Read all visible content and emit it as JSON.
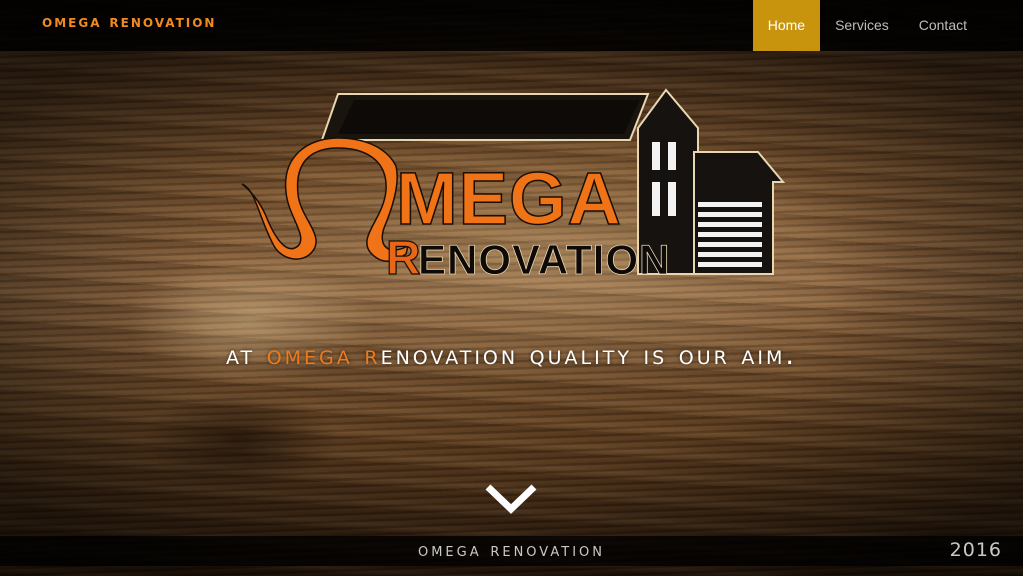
{
  "header": {
    "brand": "omega renovation",
    "nav": [
      {
        "label": "Home",
        "active": true
      },
      {
        "label": "Services",
        "active": false
      },
      {
        "label": "Contact",
        "active": false
      }
    ]
  },
  "logo": {
    "word1": "MEGA",
    "word2_initial": "R",
    "word2_rest": "ENOVATION"
  },
  "hero": {
    "tagline_part1": "at ",
    "tagline_accent1": "omega",
    "tagline_gap": " ",
    "tagline_accent2": "r",
    "tagline_part2": "enovation quality is our aim."
  },
  "footer": {
    "brand": "omega renovation",
    "year": "2016"
  },
  "colors": {
    "accent_orange": "#f07a1a",
    "nav_active": "#c8930d",
    "bar_bg": "#000000"
  },
  "icons": {
    "scroll": "chevron-down-icon"
  }
}
